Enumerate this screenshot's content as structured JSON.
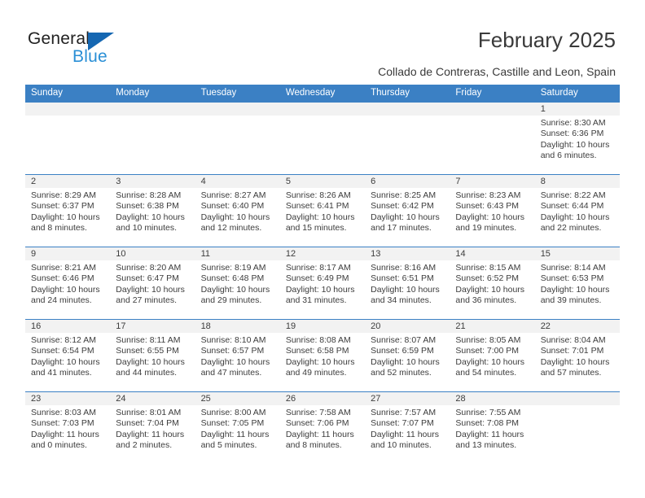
{
  "logo": {
    "word_one": "General",
    "word_two": "Blue",
    "triangle_color": "#1567b2",
    "blue_text_color": "#2a8fd6"
  },
  "header": {
    "title": "February 2025",
    "subtitle": "Collado de Contreras, Castille and Leon, Spain"
  },
  "theme": {
    "header_blue": "#3b80c4",
    "daynum_band": "#f2f2f2",
    "text": "#3c3c3c"
  },
  "weekdays": [
    "Sunday",
    "Monday",
    "Tuesday",
    "Wednesday",
    "Thursday",
    "Friday",
    "Saturday"
  ],
  "weeks": [
    {
      "days": [
        {
          "num": "",
          "sunrise": "",
          "sunset": "",
          "daylight_1": "",
          "daylight_2": ""
        },
        {
          "num": "",
          "sunrise": "",
          "sunset": "",
          "daylight_1": "",
          "daylight_2": ""
        },
        {
          "num": "",
          "sunrise": "",
          "sunset": "",
          "daylight_1": "",
          "daylight_2": ""
        },
        {
          "num": "",
          "sunrise": "",
          "sunset": "",
          "daylight_1": "",
          "daylight_2": ""
        },
        {
          "num": "",
          "sunrise": "",
          "sunset": "",
          "daylight_1": "",
          "daylight_2": ""
        },
        {
          "num": "",
          "sunrise": "",
          "sunset": "",
          "daylight_1": "",
          "daylight_2": ""
        },
        {
          "num": "1",
          "sunrise": "Sunrise: 8:30 AM",
          "sunset": "Sunset: 6:36 PM",
          "daylight_1": "Daylight: 10 hours",
          "daylight_2": "and 6 minutes."
        }
      ]
    },
    {
      "days": [
        {
          "num": "2",
          "sunrise": "Sunrise: 8:29 AM",
          "sunset": "Sunset: 6:37 PM",
          "daylight_1": "Daylight: 10 hours",
          "daylight_2": "and 8 minutes."
        },
        {
          "num": "3",
          "sunrise": "Sunrise: 8:28 AM",
          "sunset": "Sunset: 6:38 PM",
          "daylight_1": "Daylight: 10 hours",
          "daylight_2": "and 10 minutes."
        },
        {
          "num": "4",
          "sunrise": "Sunrise: 8:27 AM",
          "sunset": "Sunset: 6:40 PM",
          "daylight_1": "Daylight: 10 hours",
          "daylight_2": "and 12 minutes."
        },
        {
          "num": "5",
          "sunrise": "Sunrise: 8:26 AM",
          "sunset": "Sunset: 6:41 PM",
          "daylight_1": "Daylight: 10 hours",
          "daylight_2": "and 15 minutes."
        },
        {
          "num": "6",
          "sunrise": "Sunrise: 8:25 AM",
          "sunset": "Sunset: 6:42 PM",
          "daylight_1": "Daylight: 10 hours",
          "daylight_2": "and 17 minutes."
        },
        {
          "num": "7",
          "sunrise": "Sunrise: 8:23 AM",
          "sunset": "Sunset: 6:43 PM",
          "daylight_1": "Daylight: 10 hours",
          "daylight_2": "and 19 minutes."
        },
        {
          "num": "8",
          "sunrise": "Sunrise: 8:22 AM",
          "sunset": "Sunset: 6:44 PM",
          "daylight_1": "Daylight: 10 hours",
          "daylight_2": "and 22 minutes."
        }
      ]
    },
    {
      "days": [
        {
          "num": "9",
          "sunrise": "Sunrise: 8:21 AM",
          "sunset": "Sunset: 6:46 PM",
          "daylight_1": "Daylight: 10 hours",
          "daylight_2": "and 24 minutes."
        },
        {
          "num": "10",
          "sunrise": "Sunrise: 8:20 AM",
          "sunset": "Sunset: 6:47 PM",
          "daylight_1": "Daylight: 10 hours",
          "daylight_2": "and 27 minutes."
        },
        {
          "num": "11",
          "sunrise": "Sunrise: 8:19 AM",
          "sunset": "Sunset: 6:48 PM",
          "daylight_1": "Daylight: 10 hours",
          "daylight_2": "and 29 minutes."
        },
        {
          "num": "12",
          "sunrise": "Sunrise: 8:17 AM",
          "sunset": "Sunset: 6:49 PM",
          "daylight_1": "Daylight: 10 hours",
          "daylight_2": "and 31 minutes."
        },
        {
          "num": "13",
          "sunrise": "Sunrise: 8:16 AM",
          "sunset": "Sunset: 6:51 PM",
          "daylight_1": "Daylight: 10 hours",
          "daylight_2": "and 34 minutes."
        },
        {
          "num": "14",
          "sunrise": "Sunrise: 8:15 AM",
          "sunset": "Sunset: 6:52 PM",
          "daylight_1": "Daylight: 10 hours",
          "daylight_2": "and 36 minutes."
        },
        {
          "num": "15",
          "sunrise": "Sunrise: 8:14 AM",
          "sunset": "Sunset: 6:53 PM",
          "daylight_1": "Daylight: 10 hours",
          "daylight_2": "and 39 minutes."
        }
      ]
    },
    {
      "days": [
        {
          "num": "16",
          "sunrise": "Sunrise: 8:12 AM",
          "sunset": "Sunset: 6:54 PM",
          "daylight_1": "Daylight: 10 hours",
          "daylight_2": "and 41 minutes."
        },
        {
          "num": "17",
          "sunrise": "Sunrise: 8:11 AM",
          "sunset": "Sunset: 6:55 PM",
          "daylight_1": "Daylight: 10 hours",
          "daylight_2": "and 44 minutes."
        },
        {
          "num": "18",
          "sunrise": "Sunrise: 8:10 AM",
          "sunset": "Sunset: 6:57 PM",
          "daylight_1": "Daylight: 10 hours",
          "daylight_2": "and 47 minutes."
        },
        {
          "num": "19",
          "sunrise": "Sunrise: 8:08 AM",
          "sunset": "Sunset: 6:58 PM",
          "daylight_1": "Daylight: 10 hours",
          "daylight_2": "and 49 minutes."
        },
        {
          "num": "20",
          "sunrise": "Sunrise: 8:07 AM",
          "sunset": "Sunset: 6:59 PM",
          "daylight_1": "Daylight: 10 hours",
          "daylight_2": "and 52 minutes."
        },
        {
          "num": "21",
          "sunrise": "Sunrise: 8:05 AM",
          "sunset": "Sunset: 7:00 PM",
          "daylight_1": "Daylight: 10 hours",
          "daylight_2": "and 54 minutes."
        },
        {
          "num": "22",
          "sunrise": "Sunrise: 8:04 AM",
          "sunset": "Sunset: 7:01 PM",
          "daylight_1": "Daylight: 10 hours",
          "daylight_2": "and 57 minutes."
        }
      ]
    },
    {
      "days": [
        {
          "num": "23",
          "sunrise": "Sunrise: 8:03 AM",
          "sunset": "Sunset: 7:03 PM",
          "daylight_1": "Daylight: 11 hours",
          "daylight_2": "and 0 minutes."
        },
        {
          "num": "24",
          "sunrise": "Sunrise: 8:01 AM",
          "sunset": "Sunset: 7:04 PM",
          "daylight_1": "Daylight: 11 hours",
          "daylight_2": "and 2 minutes."
        },
        {
          "num": "25",
          "sunrise": "Sunrise: 8:00 AM",
          "sunset": "Sunset: 7:05 PM",
          "daylight_1": "Daylight: 11 hours",
          "daylight_2": "and 5 minutes."
        },
        {
          "num": "26",
          "sunrise": "Sunrise: 7:58 AM",
          "sunset": "Sunset: 7:06 PM",
          "daylight_1": "Daylight: 11 hours",
          "daylight_2": "and 8 minutes."
        },
        {
          "num": "27",
          "sunrise": "Sunrise: 7:57 AM",
          "sunset": "Sunset: 7:07 PM",
          "daylight_1": "Daylight: 11 hours",
          "daylight_2": "and 10 minutes."
        },
        {
          "num": "28",
          "sunrise": "Sunrise: 7:55 AM",
          "sunset": "Sunset: 7:08 PM",
          "daylight_1": "Daylight: 11 hours",
          "daylight_2": "and 13 minutes."
        },
        {
          "num": "",
          "sunrise": "",
          "sunset": "",
          "daylight_1": "",
          "daylight_2": ""
        }
      ]
    }
  ]
}
